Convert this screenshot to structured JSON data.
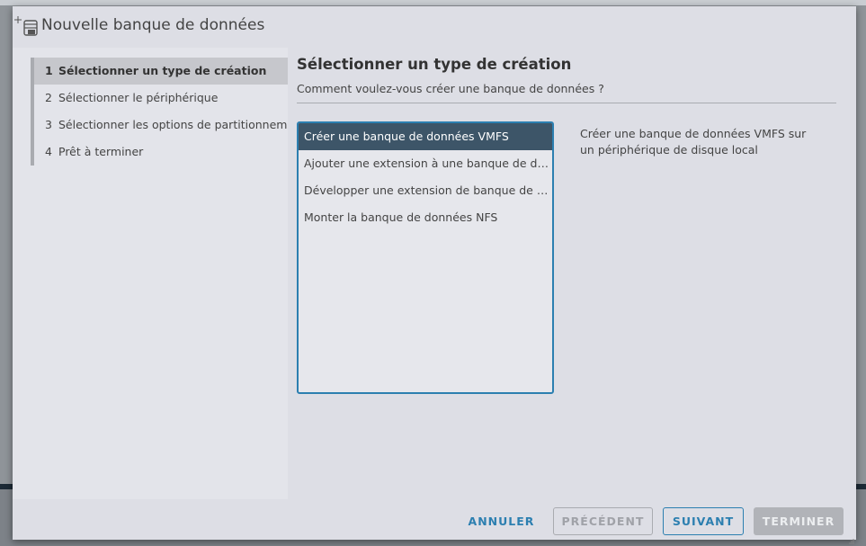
{
  "dialog": {
    "title": "Nouvelle banque de données",
    "header_icon": "datastore-add-icon"
  },
  "steps": [
    {
      "number": "1",
      "label": "Sélectionner un type de création",
      "active": true
    },
    {
      "number": "2",
      "label": "Sélectionner le périphérique",
      "active": false
    },
    {
      "number": "3",
      "label": "Sélectionner les options de partitionnement",
      "active": false
    },
    {
      "number": "4",
      "label": "Prêt à terminer",
      "active": false
    }
  ],
  "content": {
    "title": "Sélectionner un type de création",
    "subtitle": "Comment voulez-vous créer une banque de données ?",
    "options": [
      {
        "label": "Créer une banque de données VMFS",
        "selected": true
      },
      {
        "label": "Ajouter une extension à une banque de données existante",
        "selected": false
      },
      {
        "label": "Développer une extension de banque de données existante",
        "selected": false
      },
      {
        "label": "Monter la banque de données NFS",
        "selected": false
      }
    ],
    "description": "Créer une banque de données VMFS sur un périphérique de disque local"
  },
  "footer": {
    "cancel_label": "ANNULER",
    "previous_label": "PRÉCÉDENT",
    "next_label": "SUIVANT",
    "finish_label": "TERMINER"
  },
  "colors": {
    "accent": "#2c7fb0",
    "selected_bg": "#3d5568",
    "dialog_bg": "#dddee5",
    "disabled_bg": "#b1b3b8"
  }
}
